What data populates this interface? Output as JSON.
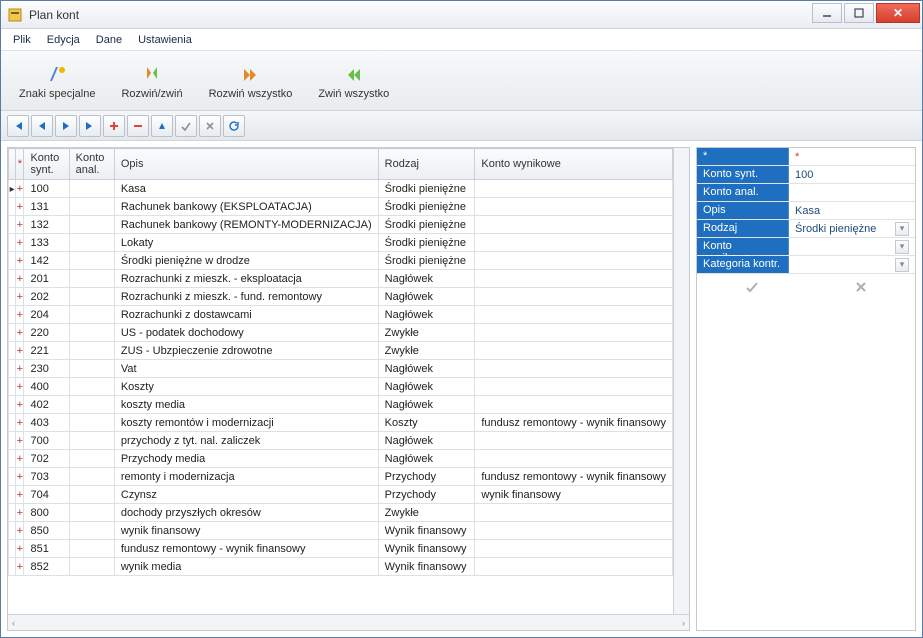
{
  "window": {
    "title": "Plan kont"
  },
  "menubar": [
    "Plik",
    "Edycja",
    "Dane",
    "Ustawienia"
  ],
  "toolbar1": [
    {
      "id": "special-chars",
      "label": "Znaki specjalne"
    },
    {
      "id": "expand-collapse",
      "label": "Rozwiń/zwiń"
    },
    {
      "id": "expand-all",
      "label": "Rozwiń wszystko"
    },
    {
      "id": "collapse-all",
      "label": "Zwiń wszystko"
    }
  ],
  "grid": {
    "headers": {
      "exp": "*",
      "konto_synt": "Konto synt.",
      "konto_anal": "Konto anal.",
      "opis": "Opis",
      "rodzaj": "Rodzaj",
      "konto_wynikowe": "Konto wynikowe"
    },
    "rows": [
      {
        "synt": "100",
        "anal": "",
        "opis": "Kasa",
        "rodzaj": "Środki pieniężne",
        "wynik": ""
      },
      {
        "synt": "131",
        "anal": "",
        "opis": "Rachunek bankowy (EKSPLOATACJA)",
        "rodzaj": "Środki pieniężne",
        "wynik": ""
      },
      {
        "synt": "132",
        "anal": "",
        "opis": "Rachunek bankowy (REMONTY-MODERNIZACJA)",
        "rodzaj": "Środki pieniężne",
        "wynik": ""
      },
      {
        "synt": "133",
        "anal": "",
        "opis": "Lokaty",
        "rodzaj": "Środki pieniężne",
        "wynik": ""
      },
      {
        "synt": "142",
        "anal": "",
        "opis": "Środki pieniężne w drodze",
        "rodzaj": "Środki pieniężne",
        "wynik": ""
      },
      {
        "synt": "201",
        "anal": "",
        "opis": "Rozrachunki z mieszk. - eksploatacja",
        "rodzaj": "Nagłówek",
        "wynik": ""
      },
      {
        "synt": "202",
        "anal": "",
        "opis": "Rozrachunki z mieszk. - fund. remontowy",
        "rodzaj": "Nagłówek",
        "wynik": ""
      },
      {
        "synt": "204",
        "anal": "",
        "opis": "Rozrachunki z dostawcami",
        "rodzaj": "Nagłówek",
        "wynik": ""
      },
      {
        "synt": "220",
        "anal": "",
        "opis": "US - podatek dochodowy",
        "rodzaj": "Zwykłe",
        "wynik": ""
      },
      {
        "synt": "221",
        "anal": "",
        "opis": "ZUS - Ubzpieczenie zdrowotne",
        "rodzaj": "Zwykłe",
        "wynik": ""
      },
      {
        "synt": "230",
        "anal": "",
        "opis": "Vat",
        "rodzaj": "Nagłówek",
        "wynik": ""
      },
      {
        "synt": "400",
        "anal": "",
        "opis": "Koszty",
        "rodzaj": "Nagłówek",
        "wynik": ""
      },
      {
        "synt": "402",
        "anal": "",
        "opis": "koszty media",
        "rodzaj": "Nagłówek",
        "wynik": ""
      },
      {
        "synt": "403",
        "anal": "",
        "opis": "koszty remontów i modernizacji",
        "rodzaj": "Koszty",
        "wynik": "fundusz remontowy - wynik finansowy"
      },
      {
        "synt": "700",
        "anal": "",
        "opis": "przychody z tyt. nal. zaliczek",
        "rodzaj": "Nagłówek",
        "wynik": ""
      },
      {
        "synt": "702",
        "anal": "",
        "opis": "Przychody media",
        "rodzaj": "Nagłówek",
        "wynik": ""
      },
      {
        "synt": "703",
        "anal": "",
        "opis": "remonty i modernizacja",
        "rodzaj": "Przychody",
        "wynik": "fundusz remontowy - wynik finansowy"
      },
      {
        "synt": "704",
        "anal": "",
        "opis": "Czynsz",
        "rodzaj": "Przychody",
        "wynik": "wynik finansowy"
      },
      {
        "synt": "800",
        "anal": "",
        "opis": "dochody przyszłych okresów",
        "rodzaj": "Zwykłe",
        "wynik": ""
      },
      {
        "synt": "850",
        "anal": "",
        "opis": "wynik finansowy",
        "rodzaj": "Wynik finansowy",
        "wynik": ""
      },
      {
        "synt": "851",
        "anal": "",
        "opis": "fundusz remontowy - wynik finansowy",
        "rodzaj": "Wynik finansowy",
        "wynik": ""
      },
      {
        "synt": "852",
        "anal": "",
        "opis": "wynik media",
        "rodzaj": "Wynik finansowy",
        "wynik": ""
      }
    ]
  },
  "sidepanel": {
    "star": "*",
    "fields": {
      "konto_synt_label": "Konto synt.",
      "konto_synt_value": "100",
      "konto_anal_label": "Konto anal.",
      "konto_anal_value": "",
      "opis_label": "Opis",
      "opis_value": "Kasa",
      "rodzaj_label": "Rodzaj",
      "rodzaj_value": "Środki pieniężne",
      "konto_wynikowe_label": "Konto wynikowe",
      "konto_wynikowe_value": "",
      "kategoria_label": "Kategoria kontr.",
      "kategoria_value": ""
    }
  }
}
